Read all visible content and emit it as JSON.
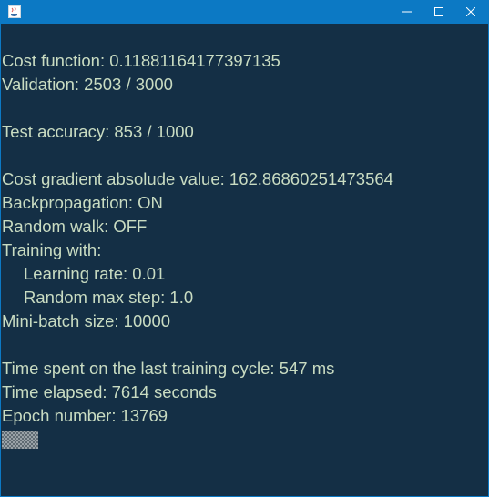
{
  "window": {
    "controls": {
      "minimize": "minimize-icon",
      "maximize": "maximize-icon",
      "close": "close-icon"
    }
  },
  "stats": {
    "cost_function": "Cost function: 0.11881164177397135",
    "validation": "Validation: 2503 / 3000",
    "test_accuracy": "Test accuracy: 853 / 1000",
    "cost_gradient": "Cost gradient absolude value: 162.86860251473564",
    "backpropagation": "Backpropagation: ON",
    "random_walk": "Random walk: OFF",
    "training_with": "Training with:",
    "learning_rate": "Learning rate: 0.01",
    "random_max_step": "Random max step: 1.0",
    "mini_batch_size": "Mini-batch size: 10000",
    "time_last_cycle": "Time spent on the last training cycle: 547 ms",
    "time_elapsed": "Time elapsed: 7614 seconds",
    "epoch_number": "Epoch number: 13769"
  },
  "colors": {
    "titlebar": "#0c79c4",
    "background": "#142f45",
    "text": "#c9dcc2"
  }
}
